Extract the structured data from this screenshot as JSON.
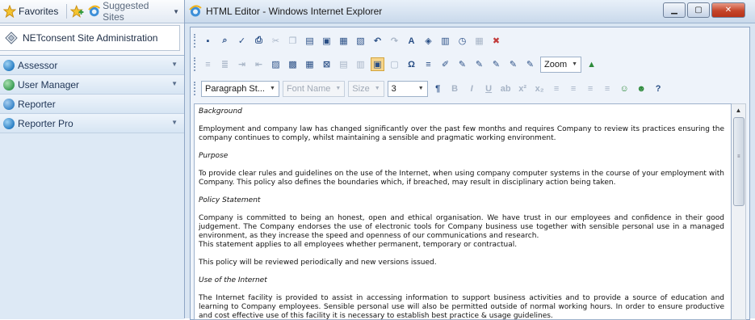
{
  "favorites_bar": {
    "favorites_label": "Favorites",
    "suggested_label": "Suggested Sites"
  },
  "left_tab": {
    "label": "NETconsent Site Administration"
  },
  "nav": {
    "items": [
      {
        "label": "Assessor",
        "icon": "assessor-icon",
        "dropdown": true
      },
      {
        "label": "User Manager",
        "icon": "user-manager-icon",
        "dropdown": true
      },
      {
        "label": "Reporter",
        "icon": "reporter-icon",
        "dropdown": false
      },
      {
        "label": "Reporter Pro",
        "icon": "reporter-pro-icon",
        "dropdown": true
      }
    ]
  },
  "window": {
    "title": "HTML Editor - Windows Internet Explorer"
  },
  "editor": {
    "paragraph_style": "Paragraph St...",
    "font_name_placeholder": "Font Name",
    "size_placeholder": "Size",
    "size_value": "3",
    "zoom_label": "Zoom",
    "document": [
      {
        "type": "heading",
        "text": "Background"
      },
      {
        "type": "para",
        "text": "Employment and company law has changed significantly over the past few months and requires Company to review its practices ensuring the company continues to comply, whilst maintaining a sensible and pragmatic working environment."
      },
      {
        "type": "heading",
        "text": "Purpose"
      },
      {
        "type": "para",
        "text": "To provide clear rules and guidelines on the use of the Internet, when using company computer systems in the course of your employment with Company. This policy also defines the boundaries which, if breached, may result in disciplinary action being taken."
      },
      {
        "type": "heading",
        "text": "Policy Statement"
      },
      {
        "type": "para",
        "text": "Company is committed to being an honest, open and ethical organisation. We have trust in our employees and confidence in their good judgement. The Company endorses the use of electronic tools for Company business use together with sensible personal use in a managed environment, as they increase the speed and openness of our communications and research."
      },
      {
        "type": "para_tight",
        "text": "This statement applies to all employees whether permanent, temporary or contractual."
      },
      {
        "type": "para",
        "text": "This policy will be reviewed periodically and new versions issued."
      },
      {
        "type": "heading",
        "text": "Use of the Internet"
      },
      {
        "type": "para",
        "text": "The Internet facility is provided to assist in accessing information to support business activities and to provide a source of education and learning to Company employees. Sensible personal use will also be permitted outside of normal working hours. In order to ensure productive and cost effective use of this facility it is necessary to establish best practice & usage guidelines."
      }
    ]
  },
  "colors": {
    "nav_background": "#dde9f5",
    "title_gradient_end": "#c9d9eb",
    "close_button": "#c5452a",
    "active_tool": "#f6d58c"
  }
}
